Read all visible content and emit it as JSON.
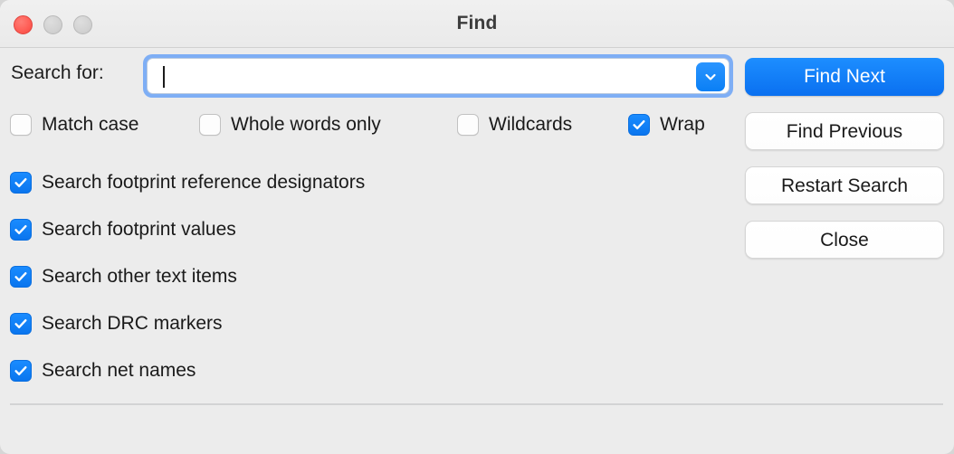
{
  "window": {
    "title": "Find",
    "traffic_lights": [
      {
        "name": "close",
        "color": "#ff5f57"
      },
      {
        "name": "minimize",
        "color": "#d2d2d2"
      },
      {
        "name": "maximize",
        "color": "#d2d2d2"
      }
    ],
    "accent_color": "#0a7ff5",
    "background_color": "#ececec"
  },
  "search": {
    "label": "Search for:",
    "value": "",
    "placeholder": "",
    "dropdown_icon": "chevron-down-icon"
  },
  "options_row": [
    {
      "label": "Match case",
      "checked": false
    },
    {
      "label": "Whole words only",
      "checked": false
    },
    {
      "label": "Wildcards",
      "checked": false
    },
    {
      "label": "Wrap",
      "checked": true
    }
  ],
  "scope_options": [
    {
      "label": "Search footprint reference designators",
      "checked": true
    },
    {
      "label": "Search footprint values",
      "checked": true
    },
    {
      "label": "Search other text items",
      "checked": true
    },
    {
      "label": "Search DRC markers",
      "checked": true
    },
    {
      "label": "Search net names",
      "checked": true
    }
  ],
  "buttons": [
    {
      "label": "Find Next",
      "style": "primary"
    },
    {
      "label": "Find Previous",
      "style": "normal"
    },
    {
      "label": "Restart Search",
      "style": "normal"
    },
    {
      "label": "Close",
      "style": "normal"
    }
  ]
}
